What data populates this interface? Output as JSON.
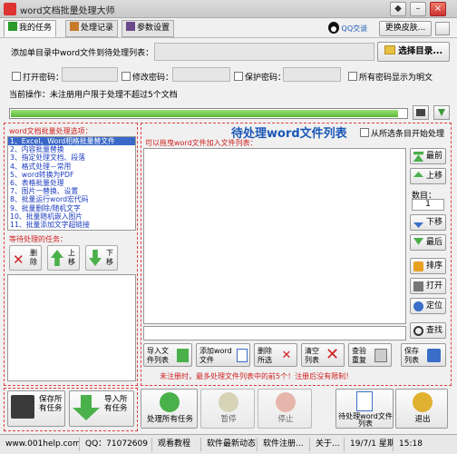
{
  "app": {
    "title": "word文档批量处理大师"
  },
  "window_buttons": {
    "skin": "◆",
    "minimize": "–",
    "close": "×"
  },
  "tabs": [
    {
      "label": "我的任务"
    },
    {
      "label": "处理记录"
    },
    {
      "label": "参数设置"
    }
  ],
  "toolbar": {
    "qq_label": "QQ交谈",
    "skin_button": "更换皮肤..."
  },
  "add_dir": {
    "label": "添加单目录中word文件到待处理列表：",
    "value": "",
    "button": "选择目录..."
  },
  "passwords": {
    "open_label": "打开密码：",
    "modify_label": "修改密码：",
    "protect_label": "保护密码：",
    "show_plain_label": "所有密码显示为明文"
  },
  "current_op": {
    "label": "当前操作：",
    "text": "未注册用户限于处理不超过5个文档"
  },
  "progress": {
    "percent": 0.98
  },
  "options_panel": {
    "title": "word文档批量处理选项：",
    "items": [
      "1、Excel、Word相格批量替文件",
      "2、内容批量替换",
      "3、指定处理文档、段落",
      "4、格式处理－常用",
      "5、word转换为PDF",
      "6、表格批量处理",
      "7、图片一替换、设置",
      "8、批量运行word宏代码",
      "9、批量删除/随机文字",
      "10、批量随机嵌入图片",
      "11、批量添加文字超链接"
    ]
  },
  "queue_panel": {
    "title": "等待处理的任务：",
    "delete": "删除",
    "up": "上移",
    "down": "下移",
    "save_all": "保存所有任务",
    "import_all": "导入所有任务"
  },
  "main_list": {
    "title": "待处理word文件列表",
    "start_from_selected": "从所选条目开始处理",
    "hint": "可以拖曳word文件加入文件列表：",
    "top": "最前",
    "up": "上移",
    "count_label": "数目：",
    "count_value": "1",
    "down": "下移",
    "bottom": "最后",
    "sort": "排序",
    "open": "打开",
    "locate": "定位",
    "find": "查找",
    "import_list": "导入文件列表",
    "add_file": "添加word文件",
    "delete_selected": "删除所选",
    "clear_list": "清空列表",
    "check_dup": "查验重复",
    "save_list": "保存列表",
    "warning": "未注册时，最多处理文件列表中的前5个！注册后没有限制！"
  },
  "actions": {
    "process_all": "处理所有任务",
    "pause": "暂停",
    "stop": "停止",
    "process_list": "待处理word文件列表",
    "exit": "退出"
  },
  "statusbar": {
    "site": "www.001help.com",
    "qq": "QQ：71072609",
    "tutorial": "观看教程",
    "news": "软件最新动态",
    "register": "软件注册...",
    "about": "关于...",
    "datetime": "19/7/1 星期一",
    "time": "15:18"
  },
  "colors": {
    "accent_red": "#d02020",
    "link_blue": "#1a3bbf",
    "green": "#5cb836"
  }
}
